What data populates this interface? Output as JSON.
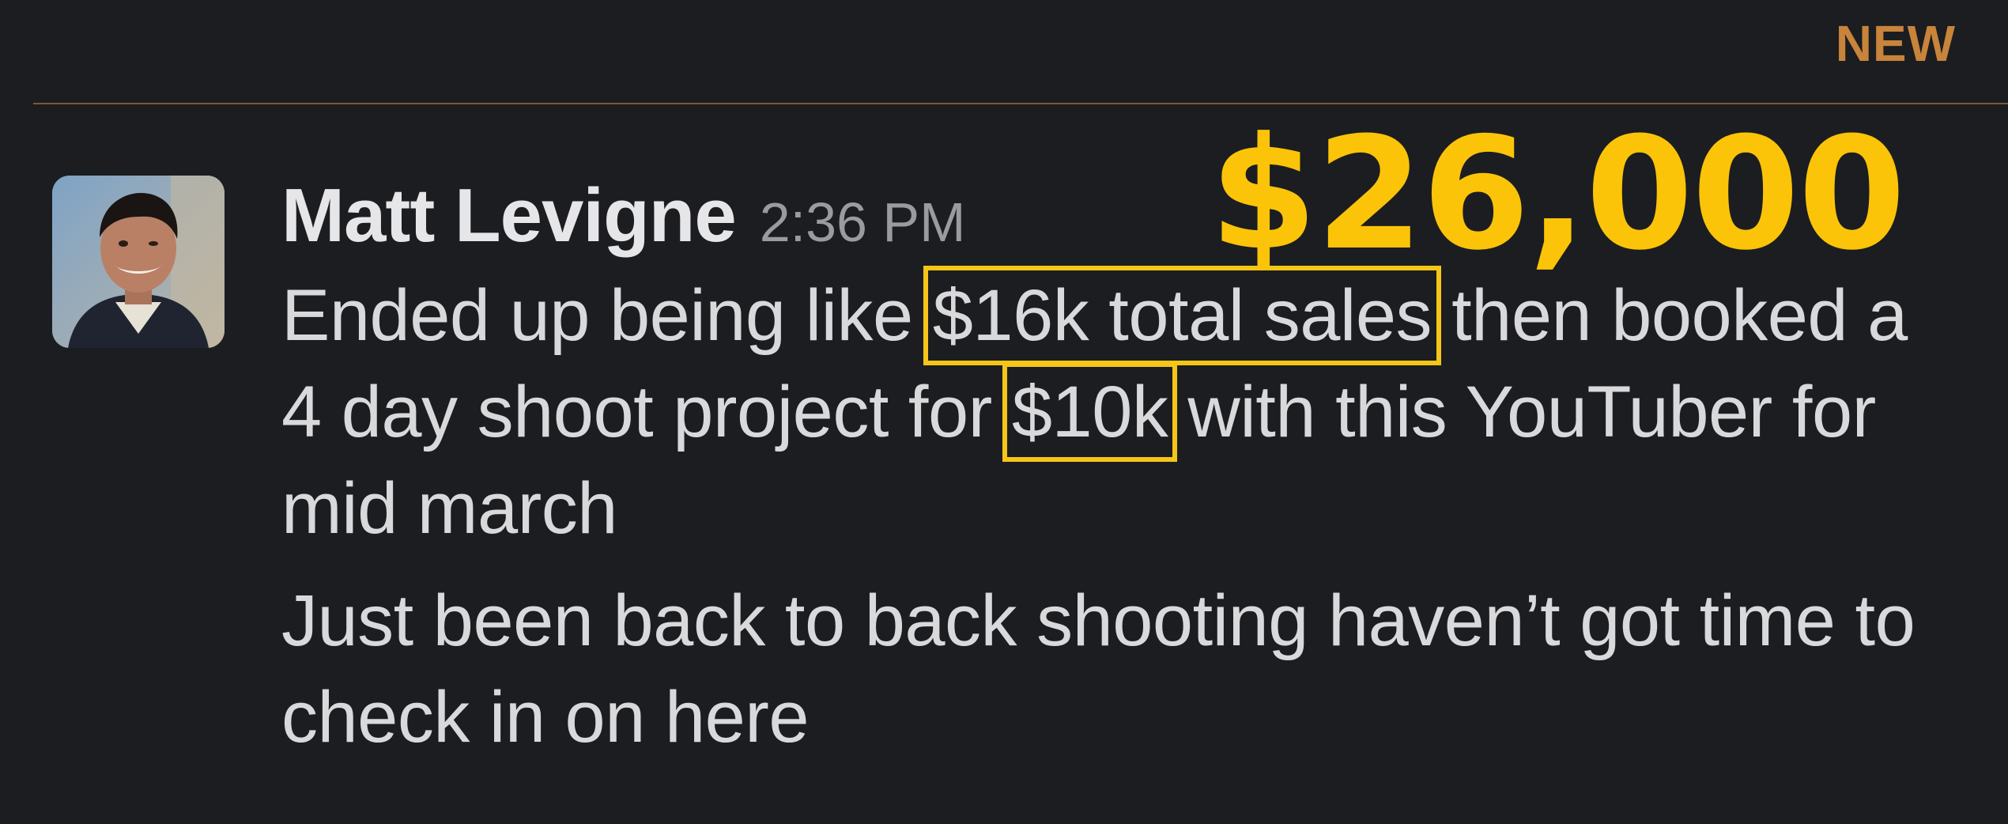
{
  "divider": {
    "label": "NEW"
  },
  "overlay": {
    "amount": "$26,000"
  },
  "message": {
    "author": "Matt Levigne",
    "time": "2:36 PM",
    "p1": {
      "before": "Ended up being like ",
      "highlight1": "$16k total sales",
      "middle": " then booked a 4 day shoot project for ",
      "highlight2": "$10k",
      "after": " with this YouTuber for mid march"
    },
    "p2": "Just been back to back shooting haven’t got time to check in on here"
  },
  "colors": {
    "background": "#1b1d21",
    "new_accent": "#c7843a",
    "highlight": "#f5c518",
    "amount": "#fbc408"
  }
}
